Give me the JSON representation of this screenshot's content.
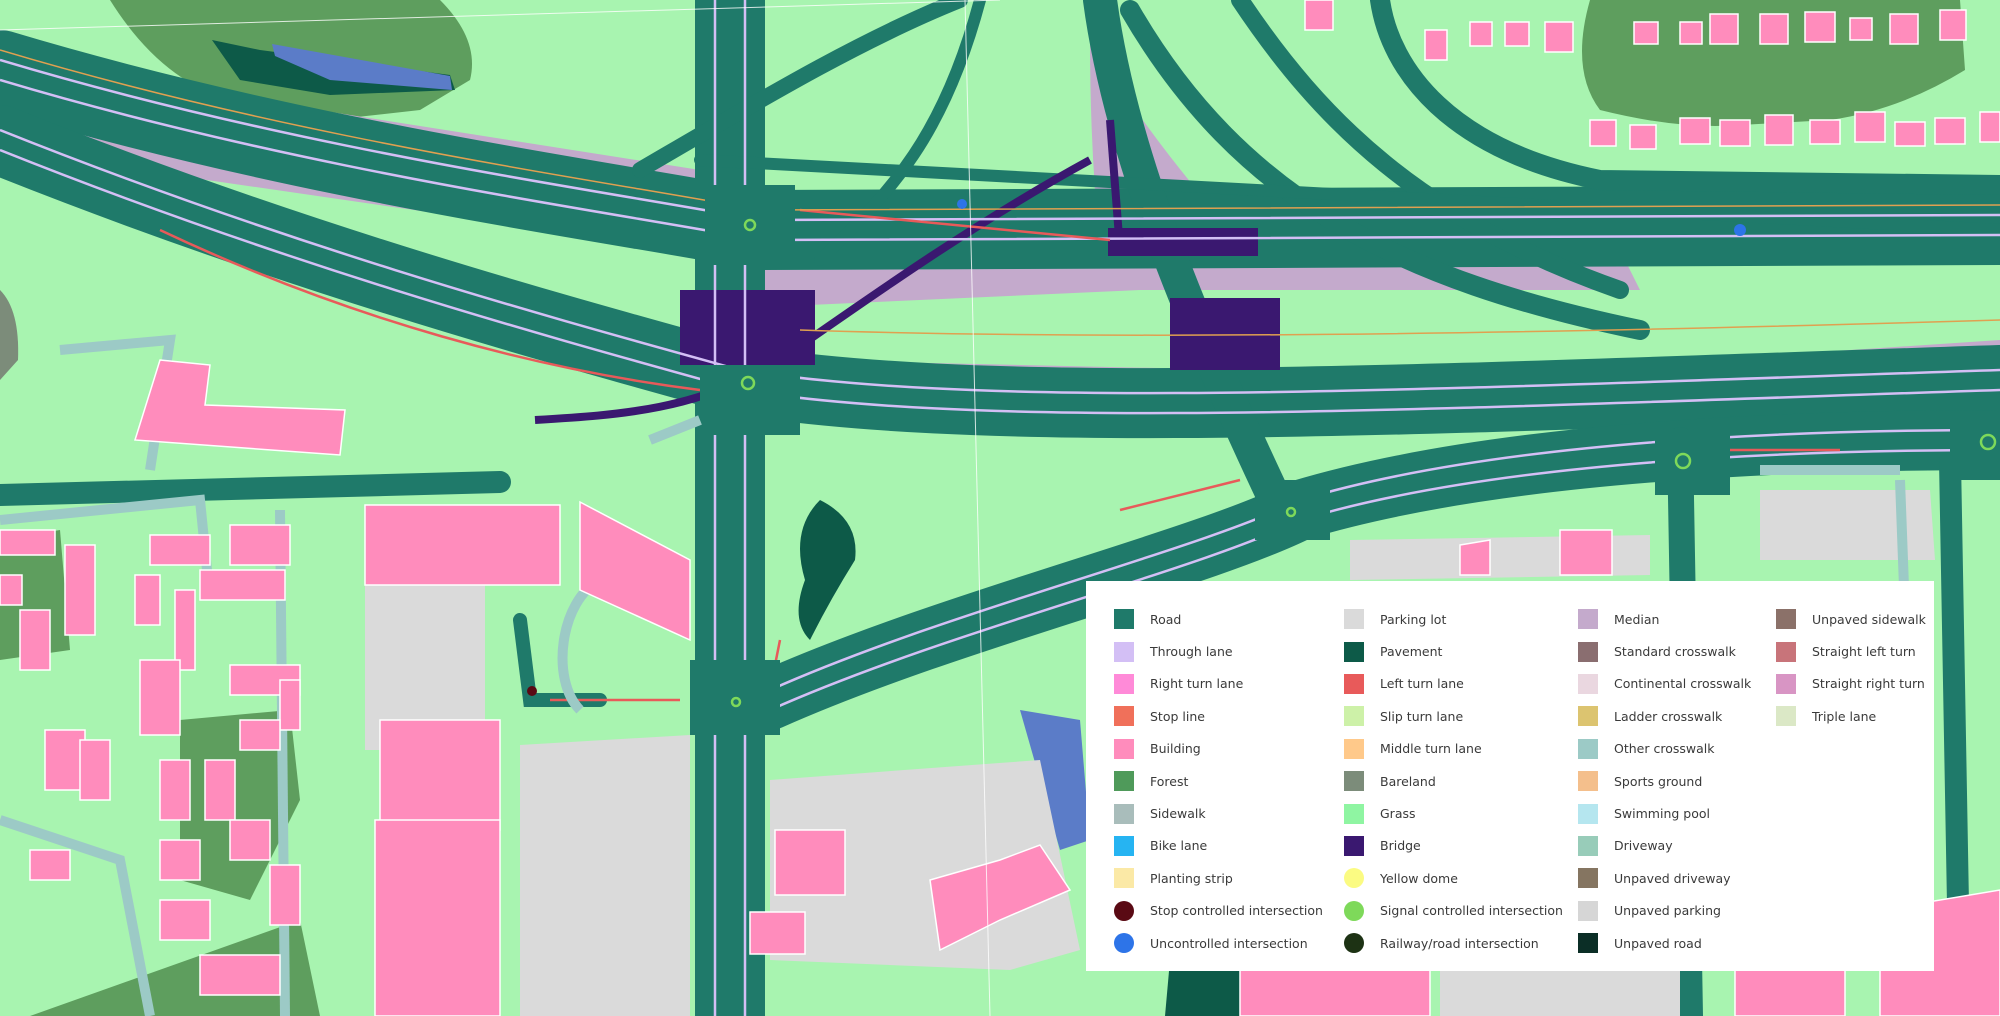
{
  "legend": {
    "columns": [
      [
        {
          "label": "Road",
          "color": "#1f7a6a",
          "shape": "square"
        },
        {
          "label": "Through lane",
          "color": "#d3bff5",
          "shape": "square"
        },
        {
          "label": "Right turn lane",
          "color": "#ff8ad8",
          "shape": "square"
        },
        {
          "label": "Stop line",
          "color": "#f0705a",
          "shape": "square"
        },
        {
          "label": "Building",
          "color": "#ff8cbc",
          "shape": "square"
        },
        {
          "label": "Forest",
          "color": "#4f9a5a",
          "shape": "square"
        },
        {
          "label": "Sidewalk",
          "color": "#a9bdbb",
          "shape": "square"
        },
        {
          "label": "Bike lane",
          "color": "#26b4f2",
          "shape": "square"
        },
        {
          "label": "Planting strip",
          "color": "#fbe9a6",
          "shape": "square"
        },
        {
          "label": "Stop controlled intersection",
          "color": "#5a0a14",
          "shape": "circle"
        },
        {
          "label": "Uncontrolled intersection",
          "color": "#2d74e8",
          "shape": "circle"
        }
      ],
      [
        {
          "label": "Parking lot",
          "color": "#dadada",
          "shape": "square"
        },
        {
          "label": "Pavement",
          "color": "#0d5a48",
          "shape": "square"
        },
        {
          "label": "Left turn lane",
          "color": "#e85a5a",
          "shape": "square"
        },
        {
          "label": "Slip turn lane",
          "color": "#cdf1a8",
          "shape": "square"
        },
        {
          "label": "Middle turn lane",
          "color": "#ffc98a",
          "shape": "square"
        },
        {
          "label": "Bareland",
          "color": "#7c8c7a",
          "shape": "square"
        },
        {
          "label": "Grass",
          "color": "#8ff5a2",
          "shape": "square"
        },
        {
          "label": "Bridge",
          "color": "#3a1870",
          "shape": "square"
        },
        {
          "label": "Yellow dome",
          "color": "#fbfb82",
          "shape": "circle"
        },
        {
          "label": "Signal controlled intersection",
          "color": "#7ed95a",
          "shape": "circle"
        },
        {
          "label": "Railway/road intersection",
          "color": "#1d3214",
          "shape": "circle"
        }
      ],
      [
        {
          "label": "Median",
          "color": "#c4aacc",
          "shape": "square"
        },
        {
          "label": "Standard crosswalk",
          "color": "#8a6e70",
          "shape": "square"
        },
        {
          "label": "Continental crosswalk",
          "color": "#ead7e0",
          "shape": "square"
        },
        {
          "label": "Ladder crosswalk",
          "color": "#dcc470",
          "shape": "square"
        },
        {
          "label": "Other crosswalk",
          "color": "#9ccac6",
          "shape": "square"
        },
        {
          "label": "Sports ground",
          "color": "#f4bf8c",
          "shape": "square"
        },
        {
          "label": "Swimming pool",
          "color": "#b5e6ef",
          "shape": "square"
        },
        {
          "label": "Driveway",
          "color": "#98ccb9",
          "shape": "square"
        },
        {
          "label": "Unpaved driveway",
          "color": "#857561",
          "shape": "square"
        },
        {
          "label": "Unpaved parking",
          "color": "#d6d6d6",
          "shape": "square"
        },
        {
          "label": "Unpaved road",
          "color": "#0b2e26",
          "shape": "square"
        }
      ],
      [
        {
          "label": "Unpaved sidewalk",
          "color": "#8b7169",
          "shape": "square"
        },
        {
          "label": "Straight left turn",
          "color": "#c8747a",
          "shape": "square"
        },
        {
          "label": "Straight right turn",
          "color": "#d895c4",
          "shape": "square"
        },
        {
          "label": "Triple lane",
          "color": "#dbe8c6",
          "shape": "square"
        }
      ]
    ]
  }
}
